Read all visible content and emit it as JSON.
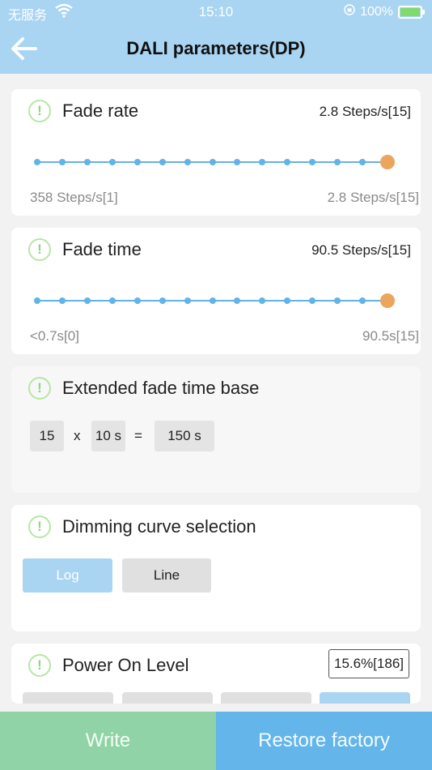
{
  "status_bar": {
    "carrier": "无服务",
    "time": "15:10",
    "battery_percent": "100%",
    "battery_level": 1.0
  },
  "header": {
    "title": "DALI parameters(DP)",
    "back_icon": "arrow-left-icon"
  },
  "fade_rate": {
    "title": "Fade rate",
    "value": "2.8 Steps/s[15]",
    "min_label": "358 Steps/s[1]",
    "max_label": "2.8 Steps/s[15]",
    "steps": 15,
    "selected": 15
  },
  "fade_time": {
    "title": "Fade time",
    "value": "90.5 Steps/s[15]",
    "min_label": "<0.7s[0]",
    "max_label": "90.5s[15]",
    "steps": 15,
    "selected": 15
  },
  "extended_fade": {
    "title": "Extended fade time base",
    "multiplier": "15",
    "times": "x",
    "base": "10 s",
    "equals": "=",
    "result": "150 s"
  },
  "dimming_curve": {
    "title": "Dimming curve selection",
    "options": [
      "Log",
      "Line"
    ],
    "selected": "Log"
  },
  "power_on_level": {
    "title": "Power On Level",
    "value": "15.6%[186]"
  },
  "footer": {
    "write": "Write",
    "restore": "Restore factory"
  },
  "colors": {
    "header_bg": "#a9d4f2",
    "slider_blue": "#61b3e8",
    "thumb_orange": "#eba55d",
    "info_green": "#8fd67b",
    "write_green": "#8fd3a6",
    "restore_blue": "#63b5ea"
  }
}
